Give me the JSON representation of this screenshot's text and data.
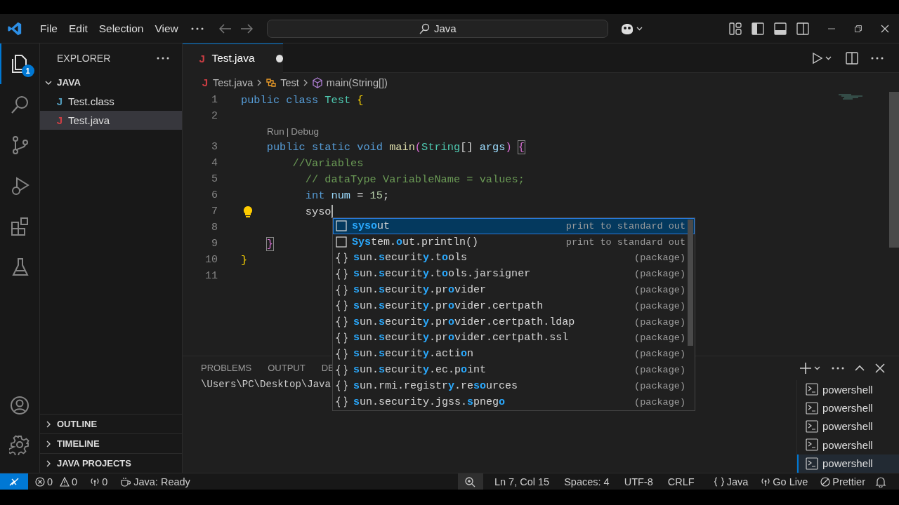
{
  "title_bar": {
    "menus": [
      {
        "label": "File"
      },
      {
        "label": "Edit"
      },
      {
        "label": "Selection"
      },
      {
        "label": "View"
      }
    ],
    "search": {
      "value": "Java"
    }
  },
  "activity_bar": {
    "items": [
      {
        "kind": "explorer",
        "selected": true,
        "badge": "1"
      },
      {
        "kind": "search",
        "selected": false
      },
      {
        "kind": "source-control",
        "selected": false
      },
      {
        "kind": "run-debug",
        "selected": false
      },
      {
        "kind": "extensions",
        "selected": false
      },
      {
        "kind": "testing",
        "selected": false
      }
    ],
    "bottom": [
      {
        "kind": "account"
      },
      {
        "kind": "settings"
      }
    ]
  },
  "sidebar": {
    "title": "EXPLORER",
    "folder": {
      "label": "JAVA",
      "expanded": true,
      "files": [
        {
          "icon": "J",
          "name": "Test.class",
          "kind": "class",
          "selected": false
        },
        {
          "icon": "J",
          "name": "Test.java",
          "kind": "java",
          "selected": true
        }
      ]
    },
    "sections": [
      {
        "label": "OUTLINE",
        "expanded": false
      },
      {
        "label": "TIMELINE",
        "expanded": false
      },
      {
        "label": "JAVA PROJECTS",
        "expanded": false
      }
    ]
  },
  "editor": {
    "tabs": [
      {
        "icon": "J",
        "label": "Test.java",
        "selected": true,
        "modified": true
      }
    ],
    "breadcrumb": [
      {
        "icon": "J",
        "label": "Test.java",
        "kind": "file"
      },
      {
        "label": "Test",
        "kind": "class"
      },
      {
        "label": "main(String[])",
        "kind": "method"
      }
    ],
    "lines": [
      {
        "kind": "code",
        "number": "1",
        "lightbulb": false,
        "cursor": false,
        "tokens": [
          {
            "text": "public class ",
            "kind": "keyword"
          },
          {
            "text": "Test ",
            "kind": "type"
          },
          {
            "text": "{",
            "kind": "bracket1"
          }
        ]
      },
      {
        "kind": "code",
        "number": "2",
        "lightbulb": false,
        "cursor": false
      },
      {
        "kind": "codelens",
        "actions": [
          "Run",
          "Debug"
        ],
        "separator": "|"
      },
      {
        "kind": "code",
        "number": "3",
        "lightbulb": false,
        "cursor": false,
        "tokens": [
          {
            "text": "    public static void ",
            "kind": "keyword"
          },
          {
            "text": "main",
            "kind": "function"
          },
          {
            "text": "(",
            "kind": "bracket2"
          },
          {
            "text": "String",
            "kind": "type"
          },
          {
            "text": "[] ",
            "kind": "plain"
          },
          {
            "text": "args",
            "kind": "variable"
          },
          {
            "text": ") ",
            "kind": "bracket2"
          },
          {
            "text": "{",
            "kind": "bracket-match"
          }
        ]
      },
      {
        "kind": "code",
        "number": "4",
        "lightbulb": false,
        "cursor": false,
        "tokens": [
          {
            "text": "        //Variables",
            "kind": "comment"
          }
        ]
      },
      {
        "kind": "code",
        "number": "5",
        "lightbulb": false,
        "cursor": false,
        "tokens": [
          {
            "text": "          // dataType VariableName = values;",
            "kind": "comment"
          }
        ]
      },
      {
        "kind": "code",
        "number": "6",
        "lightbulb": false,
        "cursor": false,
        "tokens": [
          {
            "text": "          int ",
            "kind": "keyword"
          },
          {
            "text": "num",
            "kind": "variable"
          },
          {
            "text": " = ",
            "kind": "plain"
          },
          {
            "text": "15",
            "kind": "number"
          },
          {
            "text": ";",
            "kind": "plain"
          }
        ]
      },
      {
        "kind": "code",
        "number": "7",
        "lightbulb": true,
        "cursor": true,
        "tokens": [
          {
            "text": "          syso",
            "kind": "plain"
          }
        ]
      },
      {
        "kind": "code",
        "number": "8",
        "lightbulb": false,
        "cursor": false
      },
      {
        "kind": "code",
        "number": "9",
        "lightbulb": false,
        "cursor": false,
        "tokens": [
          {
            "text": "    }",
            "kind": "bracket-match"
          }
        ]
      },
      {
        "kind": "code",
        "number": "10",
        "lightbulb": false,
        "cursor": false,
        "tokens": [
          {
            "text": "}",
            "kind": "bracket1"
          }
        ]
      },
      {
        "kind": "code",
        "number": "11",
        "lightbulb": false,
        "cursor": false
      }
    ],
    "suggestions": [
      {
        "label": "**syso**ut",
        "kind": "snippet",
        "detail": "print to standard out",
        "selected": true
      },
      {
        "label": "**Sys**tem.**o**ut.println()",
        "kind": "snippet",
        "detail": "print to standard out",
        "selected": false
      },
      {
        "label": "**s**un.**s**ecurit**y**.t**o**ols",
        "kind": "package",
        "detail": "(package)",
        "selected": false
      },
      {
        "label": "**s**un.**s**ecurit**y**.t**o**ols.jarsigner",
        "kind": "package",
        "detail": "(package)",
        "selected": false
      },
      {
        "label": "**s**un.**s**ecurit**y**.pr**o**vider",
        "kind": "package",
        "detail": "(package)",
        "selected": false
      },
      {
        "label": "**s**un.**s**ecurit**y**.pr**o**vider.certpath",
        "kind": "package",
        "detail": "(package)",
        "selected": false
      },
      {
        "label": "**s**un.**s**ecurit**y**.pr**o**vider.certpath.ldap",
        "kind": "package",
        "detail": "(package)",
        "selected": false
      },
      {
        "label": "**s**un.**s**ecurit**y**.pr**o**vider.certpath.ssl",
        "kind": "package",
        "detail": "(package)",
        "selected": false
      },
      {
        "label": "**s**un.**s**ecurit**y**.acti**o**n",
        "kind": "package",
        "detail": "(package)",
        "selected": false
      },
      {
        "label": "**s**un.**s**ecurit**y**.ec.p**o**int",
        "kind": "package",
        "detail": "(package)",
        "selected": false
      },
      {
        "label": "**s**un.rmi.registr**y**.re**so**urces",
        "kind": "package",
        "detail": "(package)",
        "selected": false
      },
      {
        "label": "**s**un.security.jgss.**s**pneg**o**",
        "kind": "package",
        "detail": "(package)",
        "selected": false
      }
    ]
  },
  "panel": {
    "tabs": [
      {
        "label": "PROBLEMS",
        "selected": false
      },
      {
        "label": "OUTPUT",
        "selected": false
      },
      {
        "label": "DE",
        "selected": false
      }
    ],
    "terminal_text": "\\Users\\PC\\Desktop\\Java",
    "terminals": [
      {
        "label": "powershell",
        "selected": false
      },
      {
        "label": "powershell",
        "selected": false
      },
      {
        "label": "powershell",
        "selected": false
      },
      {
        "label": "powershell",
        "selected": false
      },
      {
        "label": "powershell",
        "selected": true
      }
    ]
  },
  "status_bar": {
    "errors": "0",
    "warnings": "0",
    "ports": "0",
    "java_status": "Java: Ready",
    "position": "Ln 7, Col 15",
    "spaces": "Spaces: 4",
    "encoding": "UTF-8",
    "eol": "CRLF",
    "language": "Java",
    "go_live": "Go Live",
    "prettier": "Prettier"
  }
}
